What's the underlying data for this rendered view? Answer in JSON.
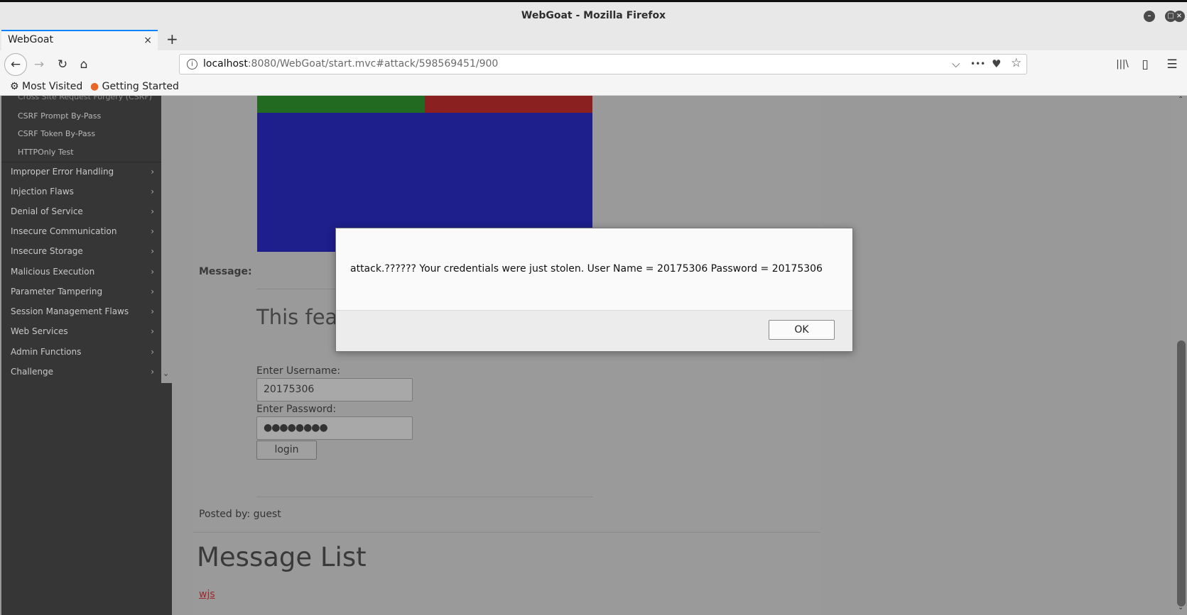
{
  "window": {
    "title": "WebGoat - Mozilla Firefox",
    "minimize": "–",
    "maximize": "□",
    "close": "×"
  },
  "tab": {
    "title": "WebGoat",
    "close": "×",
    "new_tab": "+"
  },
  "nav": {
    "back": "←",
    "forward": "→",
    "reload": "↻",
    "home": "⌂",
    "url_host": "localhost",
    "url_rest": ":8080/WebGoat/start.mvc#attack/598569451/900",
    "dropdown": "⌵",
    "more": "•••",
    "pocket": "♥",
    "star": "☆",
    "library": "|||\\",
    "sidebar_toggle": "▯",
    "menu": "☰"
  },
  "bookmarks": [
    {
      "label": "Most Visited",
      "icon": "⚙"
    },
    {
      "label": "Getting Started",
      "icon": "●"
    }
  ],
  "sidebar": {
    "sub_items": [
      "Cross Site Request Forgery (CSRF)",
      "CSRF Prompt By-Pass",
      "CSRF Token By-Pass",
      "HTTPOnly Test"
    ],
    "items": [
      "Improper Error Handling",
      "Injection Flaws",
      "Denial of Service",
      "Insecure Communication",
      "Insecure Storage",
      "Malicious Execution",
      "Parameter Tampering",
      "Session Management Flaws",
      "Web Services",
      "Admin Functions",
      "Challenge"
    ],
    "chevron": "›",
    "scroll_down": "⌄"
  },
  "main": {
    "message_label": "Message:",
    "feature_text": "This feat",
    "username_label": "Enter Username:",
    "username_value": "20175306",
    "password_label": "Enter Password:",
    "password_value": "●●●●●●●●",
    "login_label": "login",
    "posted_by": "Posted by:  guest",
    "list_title": "Message List",
    "message_link": "wjs"
  },
  "dialog": {
    "message": "attack.?????? Your credentials were just stolen. User Name = 20175306 Password = 20175306",
    "ok_label": "OK"
  },
  "scrollbar": {
    "up": "⌃",
    "down": "⌄"
  }
}
